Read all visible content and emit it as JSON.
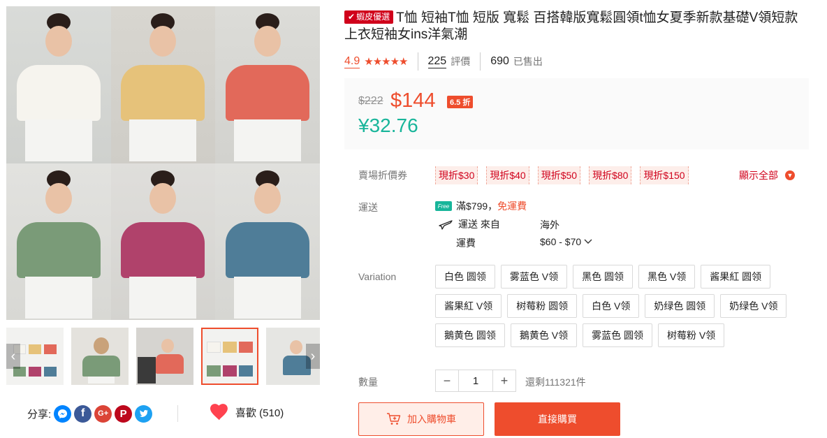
{
  "product": {
    "preferred_badge": "蝦皮優選",
    "title": "T恤 短袖T恤 短版 寬鬆 百搭韓版寬鬆圓領t恤女夏季新款基礎V領短款上衣短袖女ins洋氣潮",
    "rating": "4.9",
    "stars": "★★★★★",
    "ratings_count": "225",
    "ratings_label": "評價",
    "sold_count": "690",
    "sold_label": "已售出"
  },
  "price": {
    "original": "$222",
    "sale": "$144",
    "discount": "6.5 折",
    "cny": "¥32.76"
  },
  "vouchers": {
    "label": "賣場折價券",
    "items": [
      "現折$30",
      "現折$40",
      "現折$50",
      "現折$80",
      "現折$150"
    ],
    "show_all": "顯示全部"
  },
  "shipping": {
    "label": "運送",
    "free_icon": "Free",
    "free_threshold": "滿$799，",
    "free_text": "免運費",
    "from_label": "運送 來自",
    "from_value": "海外",
    "fee_label": "運費",
    "fee_value": "$60 - $70"
  },
  "variation": {
    "label": "Variation",
    "options": [
      "白色 圆领",
      "雾蓝色 V领",
      "黑色 圆领",
      "黑色 V领",
      "酱果紅 圆领",
      "酱果紅 V领",
      "树莓粉 圆领",
      "白色 V领",
      "奶绿色 圆领",
      "奶绿色 V领",
      "鵝黄色 圆领",
      "鵝黄色 V领",
      "雾蓝色 圆领",
      "树莓粉 V领"
    ]
  },
  "quantity": {
    "label": "數量",
    "value": "1",
    "stock": "還剩111321件"
  },
  "actions": {
    "add_to_cart": "加入購物車",
    "buy_now": "直接購買"
  },
  "share": {
    "label": "分享:",
    "like_label": "喜歡 (510)"
  },
  "colors": {
    "accent": "#ee4d2d",
    "cny": "#18b59a",
    "shirts": [
      "#f6f4ee",
      "#e6c27a",
      "#e2695a",
      "#7a9b78",
      "#b0426b",
      "#4f7d98"
    ]
  }
}
